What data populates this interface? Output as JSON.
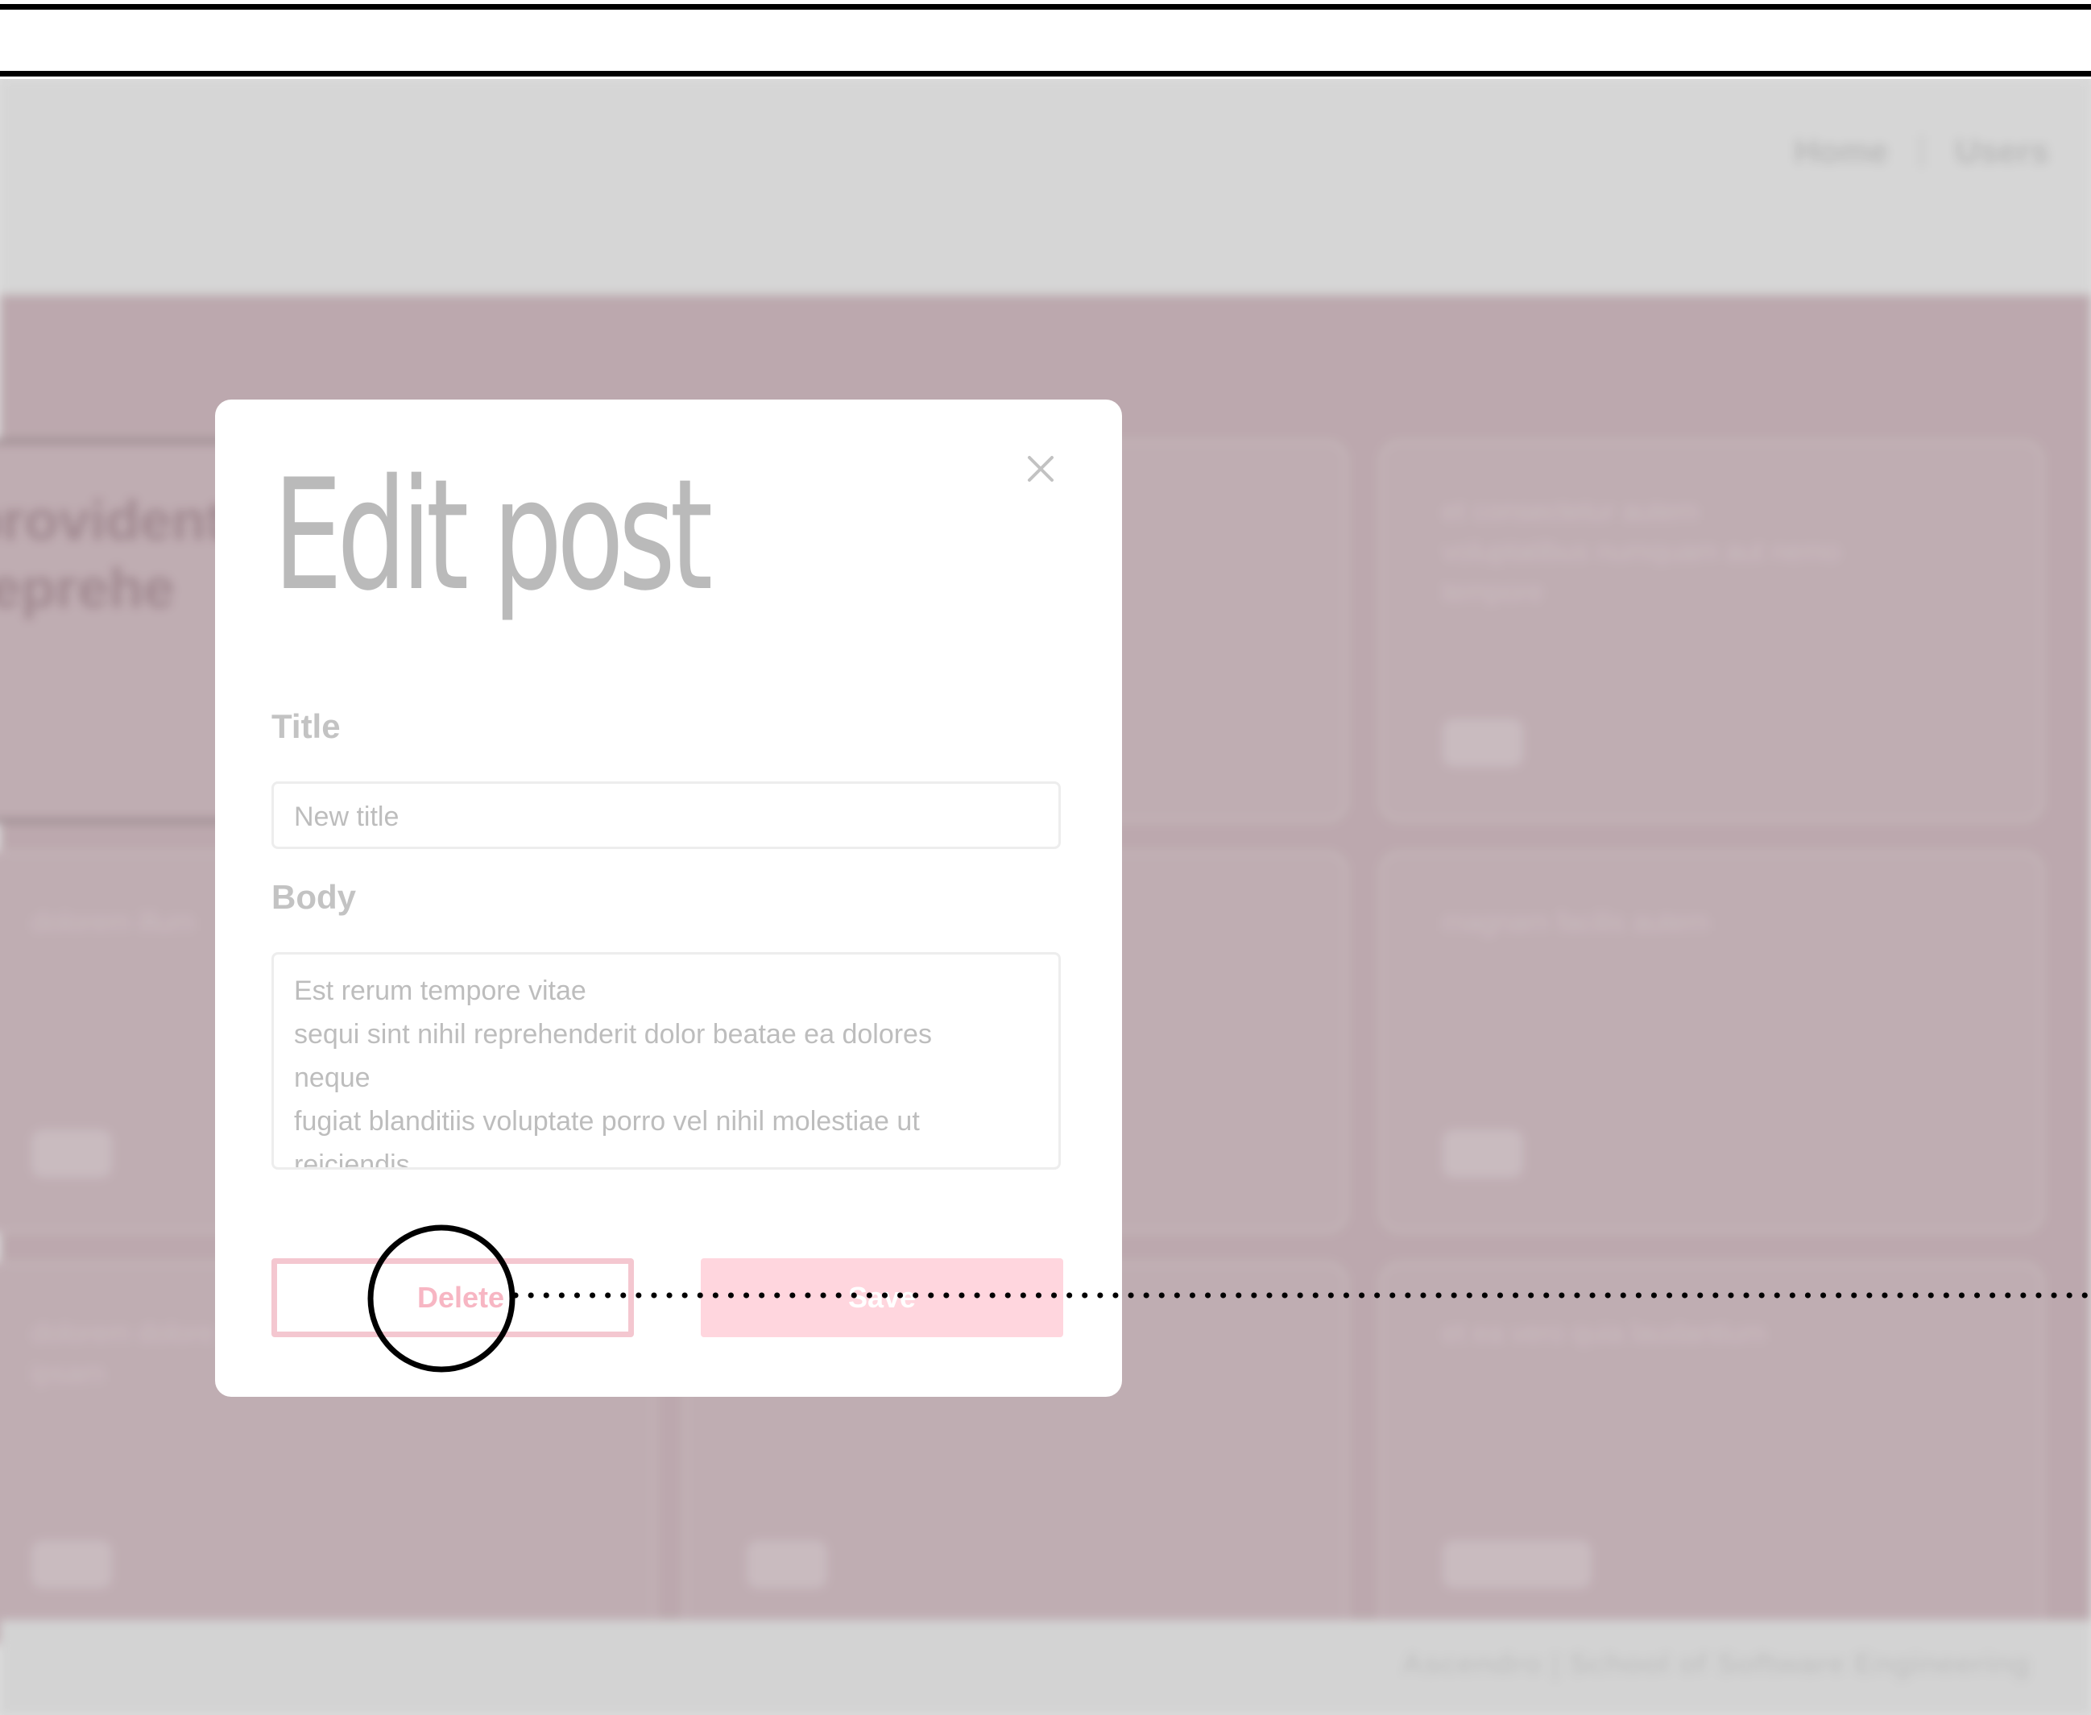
{
  "nav": {
    "home": "Home",
    "users": "Users"
  },
  "cards": [
    {
      "text": "provident\nreprehe",
      "tag": ""
    },
    {
      "text": "",
      "tag": ""
    },
    {
      "text": "et consectetur autem\nvoluptatibus numquam aut nemo\ntempore",
      "tag": ""
    },
    {
      "text": "dolorem illum",
      "tag": ""
    },
    {
      "text": "",
      "tag": ""
    },
    {
      "text": "magnam facilis autem",
      "tag": ""
    },
    {
      "text": "dolorem dolore est\nipsam",
      "tag": ""
    },
    {
      "text": "",
      "tag": ""
    },
    {
      "text": "et ea vero quia laudantium",
      "tag": ""
    }
  ],
  "footer": {
    "text": "Ascendro | School of Software Engineering"
  },
  "modal": {
    "heading": "Edit post",
    "title_label": "Title",
    "title_placeholder": "New title",
    "body_label": "Body",
    "body_lines": [
      "Est rerum tempore vitae",
      "sequi sint nihil reprehenderit dolor beatae ea dolores",
      "neque",
      "fugiat blanditiis voluptate porro vel nihil molestiae ut",
      "reiciendis"
    ],
    "delete_label": "Delete",
    "save_label": "Save"
  },
  "colors": {
    "accent": "#f7b6c3",
    "save_button": "#ffd6de",
    "background_page": "#d8c2c8"
  },
  "icons": {
    "close": "close-icon"
  }
}
